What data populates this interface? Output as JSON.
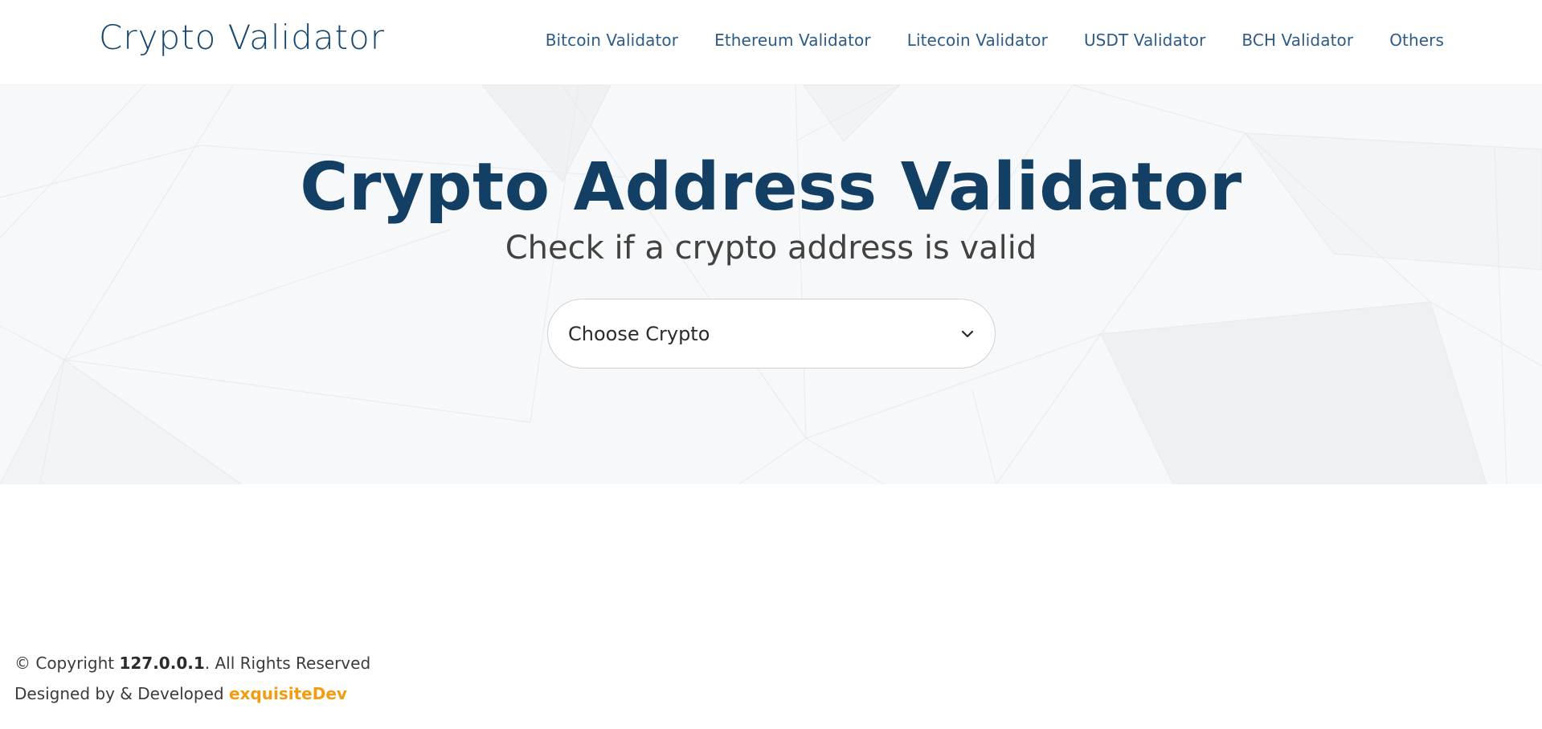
{
  "header": {
    "brand": "Crypto Validator",
    "nav": [
      {
        "label": "Bitcoin Validator"
      },
      {
        "label": "Ethereum Validator"
      },
      {
        "label": "Litecoin Validator"
      },
      {
        "label": "USDT Validator"
      },
      {
        "label": "BCH Validator"
      },
      {
        "label": "Others"
      }
    ]
  },
  "hero": {
    "title": "Crypto Address Validator",
    "subtitle": "Check if a crypto address is valid",
    "select": {
      "value": "Choose Crypto",
      "icon": "chevron-down-icon"
    }
  },
  "footer": {
    "copyright_prefix": "© Copyright ",
    "site": "127.0.0.1",
    "copyright_suffix": ". All Rights Reserved",
    "designed_text": "Designed by & Developed ",
    "designer": "exquisiteDev"
  },
  "colors": {
    "brand": "#14466e",
    "nav": "#2c5b85",
    "title": "#123f63",
    "accent": "#f39c12"
  }
}
